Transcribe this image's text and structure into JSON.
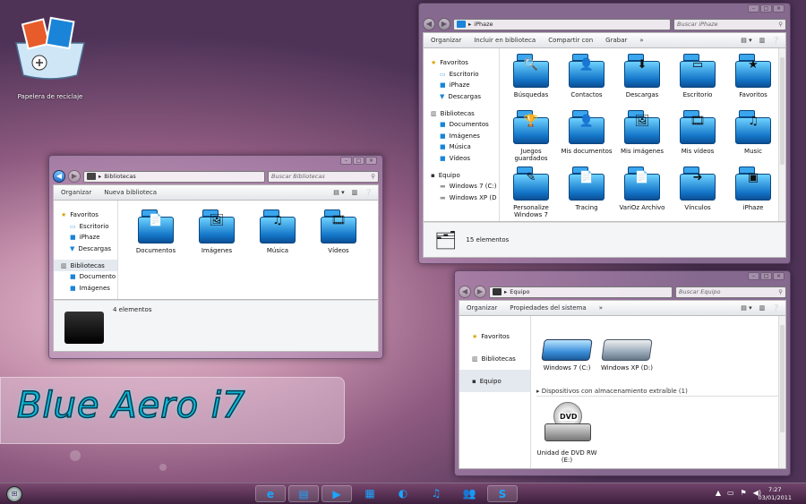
{
  "desktop": {
    "recycle_bin_label": "Papelera de reciclaje"
  },
  "brand": {
    "title": "Blue Aero i7"
  },
  "win_iphaze": {
    "address": "iPhaze",
    "search_placeholder": "Buscar iPhaze",
    "toolbar": [
      "Organizar",
      "Incluir en biblioteca",
      "Compartir con",
      "Grabar",
      "»"
    ],
    "nav": [
      {
        "label": "Favoritos",
        "icon": "star-icon",
        "head": true
      },
      {
        "label": "Escritorio",
        "icon": "desktop-icon"
      },
      {
        "label": "iPhaze",
        "icon": "folder-icon"
      },
      {
        "label": "Descargas",
        "icon": "download-icon"
      },
      {
        "label": "Bibliotecas",
        "icon": "library-icon",
        "head": true
      },
      {
        "label": "Documentos",
        "icon": "folder-icon"
      },
      {
        "label": "Imágenes",
        "icon": "folder-icon"
      },
      {
        "label": "Música",
        "icon": "folder-icon"
      },
      {
        "label": "Vídeos",
        "icon": "folder-icon"
      },
      {
        "label": "Equipo",
        "icon": "computer-icon",
        "head": true
      },
      {
        "label": "Windows 7 (C:)",
        "icon": "drive-icon"
      },
      {
        "label": "Windows XP (D",
        "icon": "drive-icon"
      }
    ],
    "items": [
      {
        "label": "Búsquedas",
        "icon": "search-folder-icon"
      },
      {
        "label": "Contactos",
        "icon": "contacts-folder-icon"
      },
      {
        "label": "Descargas",
        "icon": "downloads-folder-icon"
      },
      {
        "label": "Escritorio",
        "icon": "desktop-folder-icon"
      },
      {
        "label": "Favoritos",
        "icon": "favorites-folder-icon"
      },
      {
        "label": "Juegos guardados",
        "icon": "games-folder-icon"
      },
      {
        "label": "Mis documentos",
        "icon": "documents-folder-icon"
      },
      {
        "label": "Mis imágenes",
        "icon": "pictures-folder-icon"
      },
      {
        "label": "Mis vídeos",
        "icon": "videos-folder-icon"
      },
      {
        "label": "Music",
        "icon": "music-folder-icon"
      },
      {
        "label": "Personalize Windows 7",
        "icon": "personalize-folder-icon"
      },
      {
        "label": "Tracing",
        "icon": "tracing-folder-icon"
      },
      {
        "label": "VariOz Archivo",
        "icon": "varioz-folder-icon"
      },
      {
        "label": "Vínculos",
        "icon": "links-folder-icon"
      },
      {
        "label": "iPhaze",
        "icon": "iphaze-folder-icon"
      }
    ],
    "status": "15 elementos"
  },
  "win_libs": {
    "address": "Bibliotecas",
    "search_placeholder": "Buscar Bibliotecas",
    "toolbar": [
      "Organizar",
      "Nueva biblioteca"
    ],
    "nav": [
      {
        "label": "Favoritos",
        "icon": "star-icon",
        "head": true
      },
      {
        "label": "Escritorio",
        "icon": "desktop-icon"
      },
      {
        "label": "iPhaze",
        "icon": "folder-icon"
      },
      {
        "label": "Descargas",
        "icon": "download-icon"
      },
      {
        "label": "Bibliotecas",
        "icon": "library-icon",
        "head": true,
        "sel": true
      },
      {
        "label": "Documento",
        "icon": "folder-icon"
      },
      {
        "label": "Imágenes",
        "icon": "folder-icon"
      }
    ],
    "items": [
      {
        "label": "Documentos",
        "icon": "documents-library-icon"
      },
      {
        "label": "Imágenes",
        "icon": "pictures-library-icon"
      },
      {
        "label": "Música",
        "icon": "music-library-icon"
      },
      {
        "label": "Vídeos",
        "icon": "videos-library-icon"
      }
    ],
    "status": "4 elementos"
  },
  "win_equipo": {
    "address": "Equipo",
    "search_placeholder": "Buscar Equipo",
    "toolbar": [
      "Organizar",
      "Propiedades del sistema",
      "»"
    ],
    "nav": [
      {
        "label": "Favoritos",
        "icon": "star-icon"
      },
      {
        "label": "Bibliotecas",
        "icon": "library-icon"
      },
      {
        "label": "Equipo",
        "icon": "computer-icon",
        "sel": true
      }
    ],
    "drives": [
      {
        "label": "Windows 7 (C:)",
        "icon": "hard-drive-icon"
      },
      {
        "label": "Windows XP (D:)",
        "icon": "hard-drive-icon"
      }
    ],
    "removable_header": "Dispositivos con almacenamiento extraíble (1)",
    "dvd": {
      "label": "Unidad de DVD RW (E:)",
      "badge": "DVD"
    }
  },
  "taskbar": {
    "apps": [
      "ie-icon",
      "explorer-icon",
      "media-player-icon",
      "calculator-icon",
      "browser-icon",
      "music-icon",
      "messenger-icon",
      "skype-icon"
    ],
    "time": "7:27",
    "date": "03/01/2011"
  }
}
